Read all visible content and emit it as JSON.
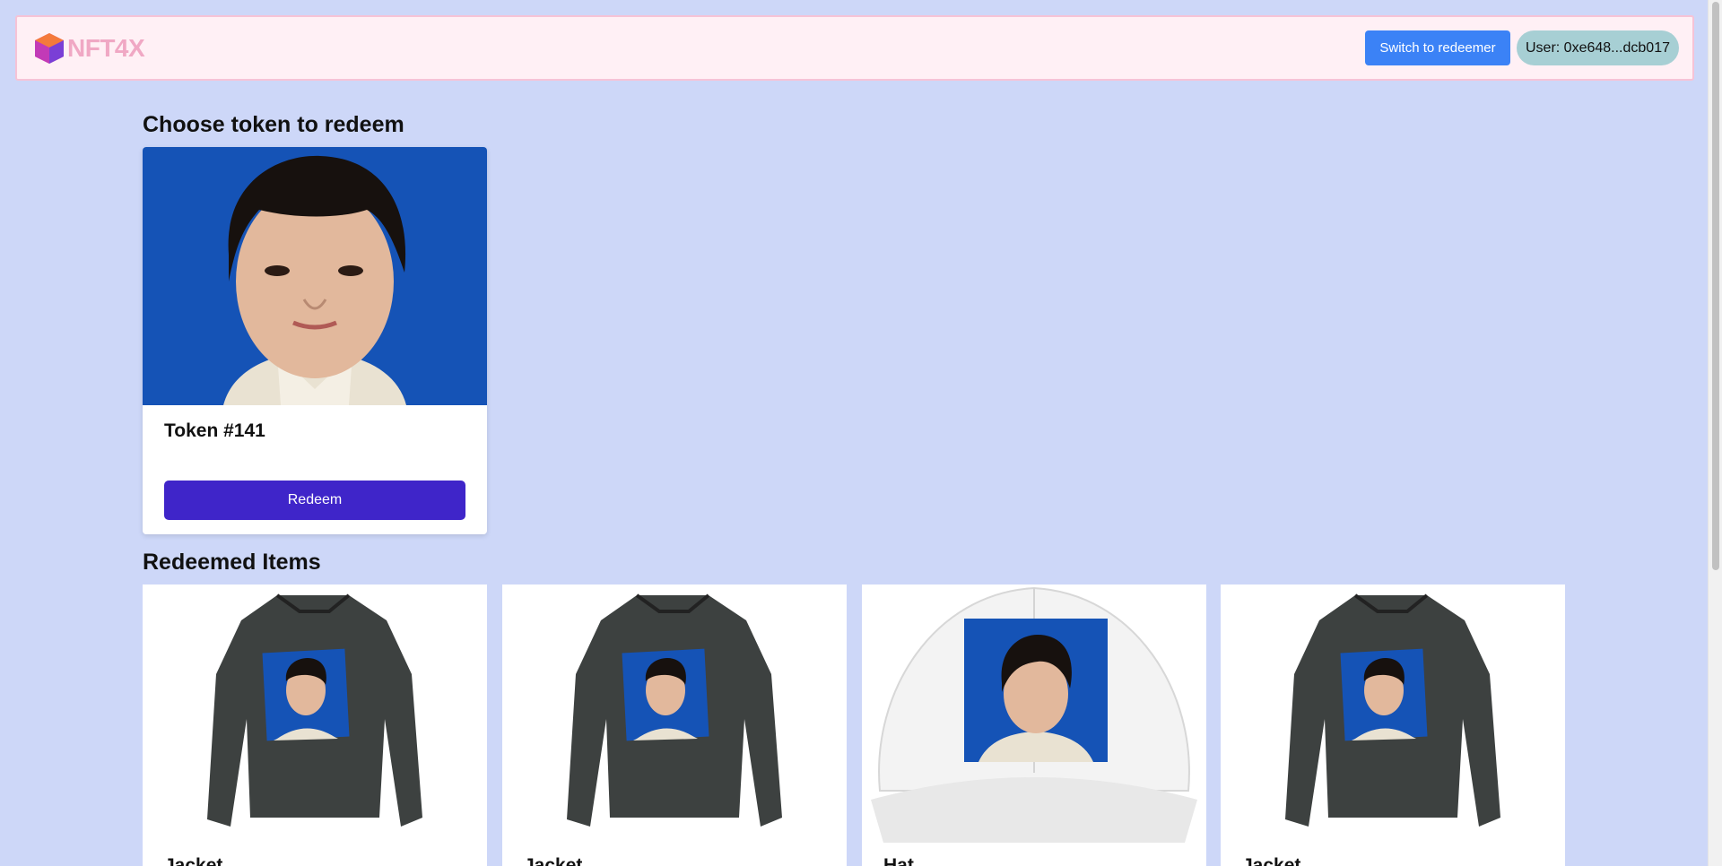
{
  "header": {
    "logo_text": "NFT4X",
    "switch_button": "Switch to redeemer",
    "user_label": "User: 0xe648...dcb017"
  },
  "choose": {
    "title": "Choose token to redeem",
    "tokens": [
      {
        "name": "Token #141",
        "button": "Redeem"
      }
    ]
  },
  "redeemed": {
    "title": "Redeemed Items",
    "items": [
      {
        "label": "Jacket",
        "kind": "jacket-icon"
      },
      {
        "label": "Jacket",
        "kind": "jacket-icon"
      },
      {
        "label": "Hat",
        "kind": "hat-icon"
      },
      {
        "label": "Jacket",
        "kind": "jacket-icon"
      }
    ]
  },
  "colors": {
    "page_bg": "#cdd7f8",
    "header_bg": "#fff0f5",
    "switch_button": "#3b82f6",
    "redeem_button": "#3f25c9",
    "user_pill": "#a7cfd4"
  }
}
